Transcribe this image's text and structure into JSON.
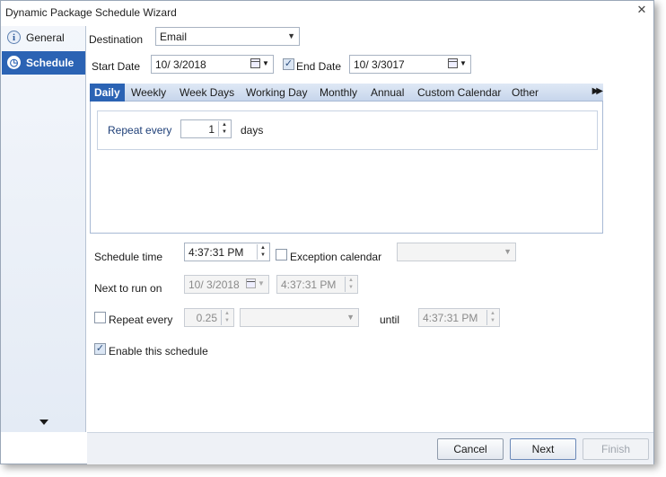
{
  "window": {
    "title": "Dynamic Package Schedule Wizard",
    "close_glyph": "✕"
  },
  "sidebar": {
    "items": [
      {
        "label": "General",
        "icon": "info-icon",
        "icon_glyph": "i"
      },
      {
        "label": "Schedule",
        "icon": "clock-icon",
        "icon_glyph": "◷"
      }
    ]
  },
  "form": {
    "destination_label": "Destination",
    "destination_value": "Email",
    "start_date_label": "Start Date",
    "start_date_value": "10/  3/2018",
    "end_date_label": "End Date",
    "end_date_checked": true,
    "end_date_value": "10/  3/3017"
  },
  "tabs": [
    {
      "label": "Daily",
      "active": true
    },
    {
      "label": "Weekly"
    },
    {
      "label": "Week Days"
    },
    {
      "label": "Working Day"
    },
    {
      "label": "Monthly"
    },
    {
      "label": "Annual"
    },
    {
      "label": "Custom Calendar"
    },
    {
      "label": "Other"
    }
  ],
  "daily": {
    "repeat_every_label": "Repeat every",
    "repeat_every_value": "1",
    "unit_label": "days"
  },
  "schedule": {
    "schedule_time_label": "Schedule time",
    "schedule_time_value": "4:37:31 PM",
    "exception_calendar_label": "Exception calendar",
    "exception_calendar_checked": false,
    "exception_calendar_value": "",
    "next_run_label": "Next to run on",
    "next_run_date": "10/  3/2018",
    "next_run_time": "4:37:31 PM",
    "repeat_every_label": "Repeat every",
    "repeat_every_checked": false,
    "repeat_every_value": "0.25",
    "repeat_unit_value": "",
    "until_label": "until",
    "until_value": "4:37:31 PM",
    "enable_label": "Enable this schedule",
    "enable_checked": true
  },
  "buttons": {
    "cancel": "Cancel",
    "next": "Next",
    "finish": "Finish"
  },
  "colors": {
    "accent": "#2b63b4",
    "sidebar_bg": "#e4ebf5",
    "tabbar_bg": "#c7d6ec"
  }
}
